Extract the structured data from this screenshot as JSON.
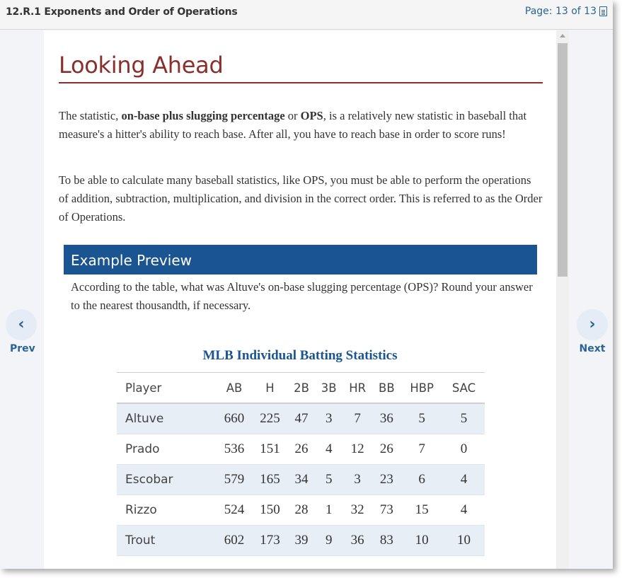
{
  "header": {
    "title": "12.R.1 Exponents and Order of Operations",
    "page_indicator": "Page: 13 of 13",
    "page_icon": "document-icon"
  },
  "nav": {
    "prev_label": "Prev",
    "next_label": "Next",
    "prev_icon": "chevron-left-icon",
    "next_icon": "chevron-right-icon"
  },
  "content": {
    "heading": "Looking Ahead",
    "para1_part1": "The statistic, ",
    "para1_bold1": "on-base plus slugging percentage",
    "para1_part2": " or ",
    "para1_bold2": "OPS",
    "para1_part3": ", is a relatively new statistic in baseball that measure's a hitter's ability to reach base. After all, you have to reach base in order to score runs!",
    "para2": "To be able to calculate many baseball statistics, like OPS, you must be able to perform the operations of addition, subtraction, multiplication, and division in the correct order. This is referred to as the Order of Operations.",
    "example_title": "Example Preview",
    "example_text": "According to the table, what was Altuve's on-base slugging percentage (OPS)? Round your answer to the nearest thousandth, if necessary."
  },
  "table": {
    "title": "MLB Individual Batting Statistics",
    "headers": [
      "Player",
      "AB",
      "H",
      "2B",
      "3B",
      "HR",
      "BB",
      "HBP",
      "SAC"
    ],
    "rows": [
      [
        "Altuve",
        "660",
        "225",
        "47",
        "3",
        "7",
        "36",
        "5",
        "5"
      ],
      [
        "Prado",
        "536",
        "151",
        "26",
        "4",
        "12",
        "26",
        "7",
        "0"
      ],
      [
        "Escobar",
        "579",
        "165",
        "34",
        "5",
        "3",
        "23",
        "6",
        "4"
      ],
      [
        "Rizzo",
        "524",
        "150",
        "28",
        "1",
        "32",
        "73",
        "15",
        "4"
      ],
      [
        "Trout",
        "602",
        "173",
        "39",
        "9",
        "36",
        "83",
        "10",
        "10"
      ]
    ]
  },
  "colors": {
    "heading": "#8b2f2b",
    "accent_blue": "#1a5491",
    "link_blue": "#2a6496",
    "row_shade": "#e8eef5"
  }
}
